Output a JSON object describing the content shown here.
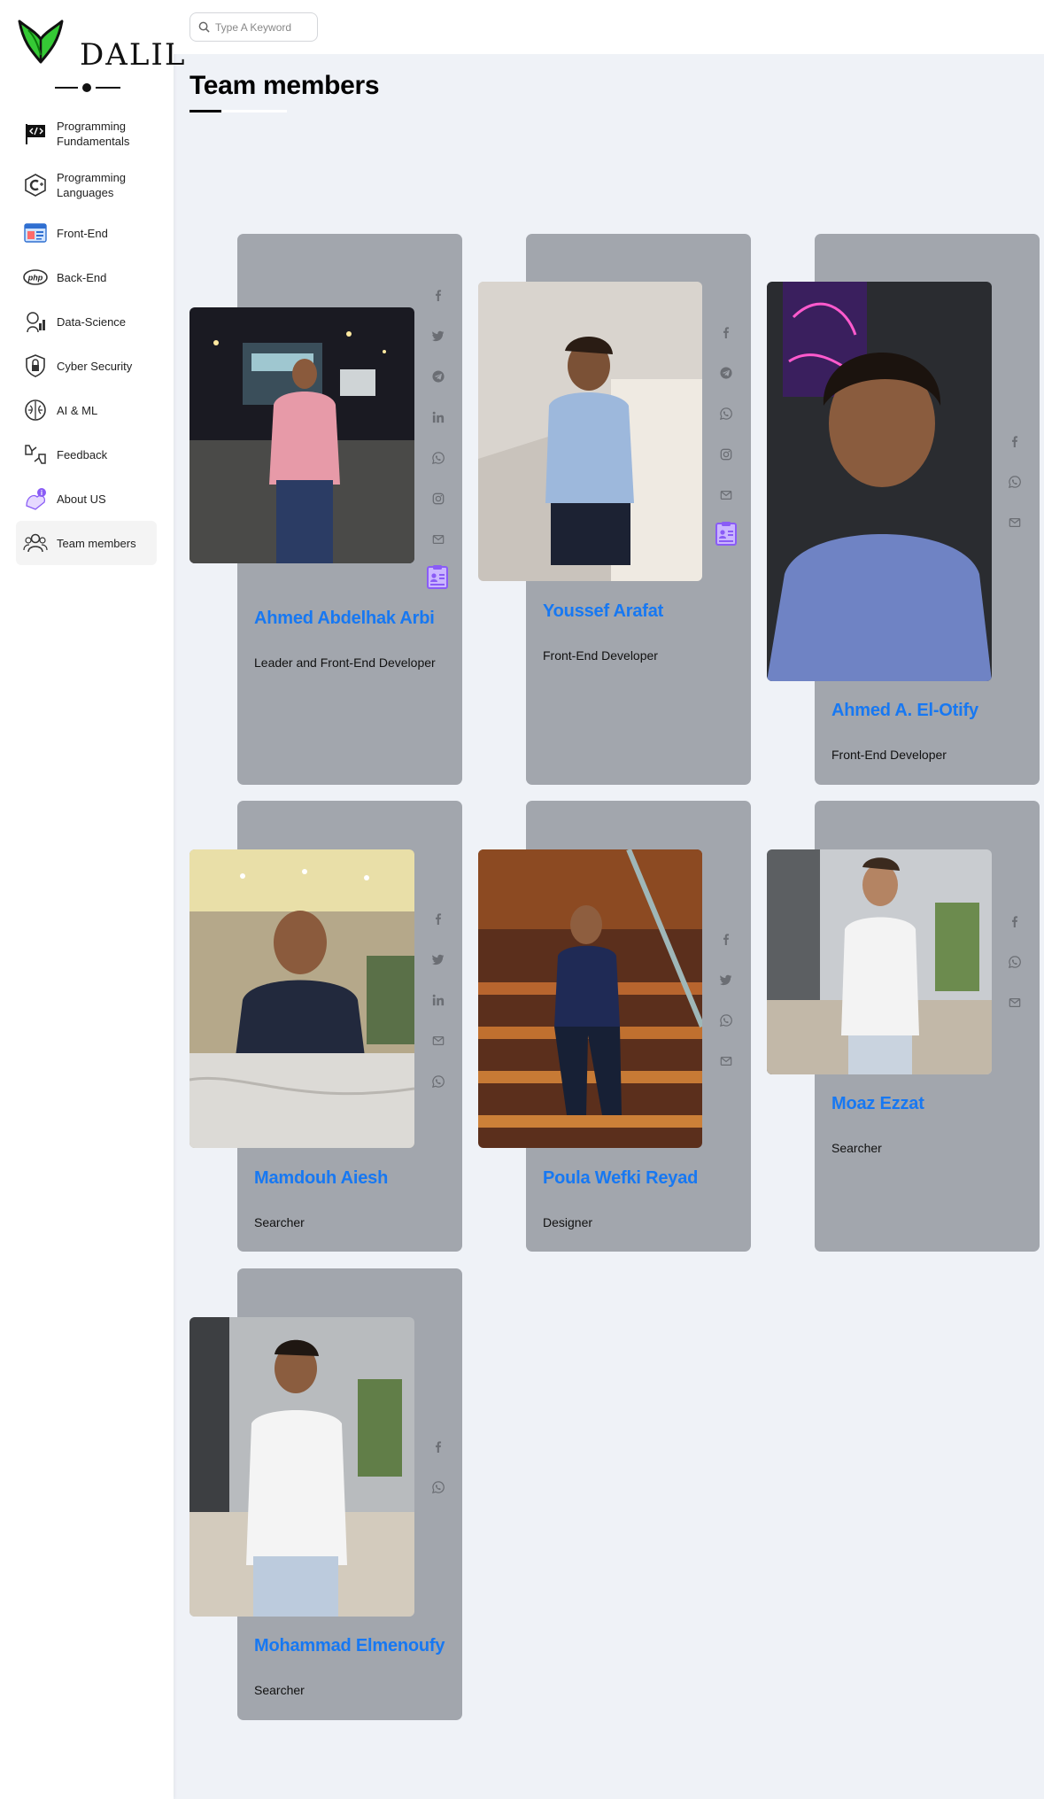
{
  "brand": {
    "name": "DALIL",
    "accent": "#33cc33"
  },
  "search": {
    "placeholder": "Type A Keyword",
    "icon": "search-icon"
  },
  "page": {
    "title": "Team members"
  },
  "sidebar": {
    "items": [
      {
        "label": "Programming Fundamentals",
        "icon": "code-flag-icon"
      },
      {
        "label": "Programming Languages",
        "icon": "c-language-icon"
      },
      {
        "label": "Front-End",
        "icon": "browser-window-icon"
      },
      {
        "label": "Back-End",
        "icon": "php-icon"
      },
      {
        "label": "Data-Science",
        "icon": "data-science-icon"
      },
      {
        "label": "Cyber Security",
        "icon": "shield-lock-icon"
      },
      {
        "label": "AI & ML",
        "icon": "brain-icon"
      },
      {
        "label": "Feedback",
        "icon": "thumbs-icon"
      },
      {
        "label": "About US",
        "icon": "info-icon"
      },
      {
        "label": "Team members",
        "icon": "team-icon",
        "active": true
      }
    ]
  },
  "members": [
    {
      "name": "Ahmed Abdelhak Arbi",
      "role": "Leader and Front-End Developer",
      "socials": [
        "facebook-icon",
        "twitter-icon",
        "telegram-icon",
        "linkedin-icon",
        "whatsapp-icon",
        "instagram-icon",
        "email-icon"
      ],
      "has_cv": true
    },
    {
      "name": "Youssef Arafat",
      "role": "Front-End Developer",
      "socials": [
        "facebook-icon",
        "telegram-icon",
        "whatsapp-icon",
        "instagram-icon",
        "email-icon"
      ],
      "has_cv": true
    },
    {
      "name": "Ahmed A. El-Otify",
      "role": "Front-End Developer",
      "socials": [
        "facebook-icon",
        "whatsapp-icon",
        "email-icon"
      ],
      "has_cv": false
    },
    {
      "name": "Mamdouh Aiesh",
      "role": "Searcher",
      "socials": [
        "facebook-icon",
        "twitter-icon",
        "linkedin-icon",
        "email-icon",
        "whatsapp-icon"
      ],
      "has_cv": false
    },
    {
      "name": "Poula Wefki Reyad",
      "role": "Designer",
      "socials": [
        "facebook-icon",
        "twitter-icon",
        "whatsapp-icon",
        "email-icon"
      ],
      "has_cv": false
    },
    {
      "name": "Moaz Ezzat",
      "role": "Searcher",
      "socials": [
        "facebook-icon",
        "whatsapp-icon",
        "email-icon"
      ],
      "has_cv": false
    },
    {
      "name": "Mohammad Elmenoufy",
      "role": "Searcher",
      "socials": [
        "facebook-icon",
        "whatsapp-icon"
      ],
      "has_cv": false
    }
  ],
  "colors": {
    "name": "#1778f2",
    "card": "#a2a6ad",
    "page_bg": "#eff2f7",
    "cv_icon": "#8a5cf6"
  }
}
